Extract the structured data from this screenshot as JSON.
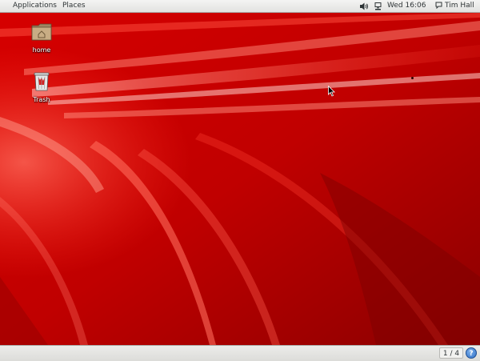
{
  "top_panel": {
    "applications_label": "Applications",
    "places_label": "Places",
    "clock": "Wed 16:06",
    "user_name": "Tim Hall",
    "volume_icon": "volume-icon",
    "network_icon": "network-icon",
    "user_icon": "chat-status-icon"
  },
  "desktop": {
    "icons": [
      {
        "label": "home",
        "icon": "home-folder-icon"
      },
      {
        "label": "Trash",
        "icon": "trash-icon"
      }
    ],
    "wallpaper_colors": {
      "base": "#c40000",
      "highlight": "#ff4a3a",
      "dark": "#7a0000"
    }
  },
  "bottom_panel": {
    "workspace": "1 / 4",
    "help_icon": "?"
  }
}
